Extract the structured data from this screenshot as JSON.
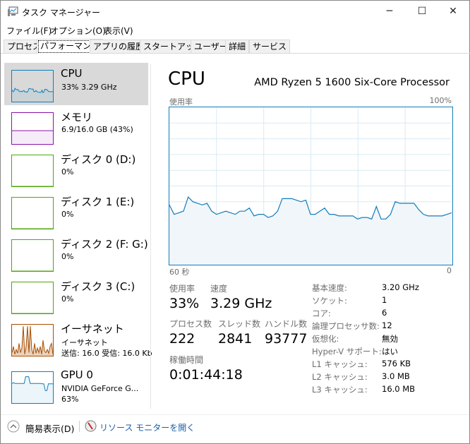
{
  "window": {
    "title": "タスク マネージャー",
    "minimize": "─",
    "maximize": "☐",
    "close": "✕"
  },
  "menu": [
    "ファイル(F)",
    "オプション(O)",
    "表示(V)"
  ],
  "tabs": [
    {
      "label": "プロセス"
    },
    {
      "label": "パフォーマンス",
      "active": true
    },
    {
      "label": "アプリの履歴"
    },
    {
      "label": "スタートアップ"
    },
    {
      "label": "ユーザー"
    },
    {
      "label": "詳細"
    },
    {
      "label": "サービス"
    }
  ],
  "sidebar": [
    {
      "name": "CPU",
      "sub": "33%  3.29 GHz",
      "color": "#117dbb",
      "selected": true,
      "spark": [
        38,
        32,
        34,
        43,
        39,
        38,
        39,
        34,
        32,
        34,
        32,
        34,
        36,
        31,
        32,
        30,
        34,
        42,
        42,
        41,
        40,
        41,
        32,
        32,
        36,
        32,
        31,
        31,
        29,
        30,
        37,
        29,
        32,
        40,
        39,
        39,
        35,
        32,
        32,
        32,
        32,
        33
      ]
    },
    {
      "name": "メモリ",
      "sub": "6.9/16.0 GB (43%)",
      "color": "#8b12ae",
      "spark": [
        43,
        43,
        43,
        43,
        43,
        43,
        43,
        43,
        43,
        43
      ]
    },
    {
      "name": "ディスク 0 (D:)",
      "sub": "0%",
      "color": "#4da60c",
      "spark": [
        0,
        0
      ]
    },
    {
      "name": "ディスク 1 (E:)",
      "sub": "0%",
      "color": "#4da60c",
      "spark": [
        0,
        0
      ]
    },
    {
      "name": "ディスク 2 (F: G:)",
      "sub": "0%",
      "color": "#4da60c",
      "spark": [
        0,
        0
      ]
    },
    {
      "name": "ディスク 3 (C:)",
      "sub": "0%",
      "color": "#4da60c",
      "spark": [
        0,
        0
      ]
    },
    {
      "name": "イーサネット",
      "sub": "イーサネット",
      "sub2": "送信: 16.0 受信: 16.0 Kb",
      "color": "#a74f01",
      "spark": [
        10,
        30,
        5,
        20,
        8,
        40,
        10,
        25,
        95,
        5,
        30,
        95,
        10,
        95,
        20,
        5,
        40,
        8,
        25,
        10,
        30,
        5,
        50,
        15,
        10,
        20,
        8,
        30,
        40,
        5
      ]
    },
    {
      "name": "GPU 0",
      "sub": "NVIDIA GeForce G...",
      "sub2": "63%",
      "color": "#117dbb",
      "spark": [
        63,
        66,
        63,
        63,
        63,
        63,
        63,
        63,
        63,
        85,
        85,
        85,
        63,
        63,
        63,
        63,
        63,
        63,
        63,
        63,
        62,
        62,
        40,
        40,
        62,
        62,
        62,
        62
      ]
    }
  ],
  "main": {
    "title": "CPU",
    "processor": "AMD Ryzen 5 1600 Six-Core Processor",
    "graph_label": "使用率",
    "graph_max": "100%",
    "graph_time": "60 秒",
    "graph_min": "0",
    "stats": {
      "usage_label": "使用率",
      "usage": "33%",
      "speed_label": "速度",
      "speed": "3.29 GHz",
      "proc_label": "プロセス数",
      "proc": "222",
      "threads_label": "スレッド数",
      "threads": "2841",
      "handles_label": "ハンドル数",
      "handles": "93777",
      "uptime_label": "稼働時間",
      "uptime": "0:01:44:18"
    },
    "details": [
      [
        "基本速度:",
        "3.20 GHz"
      ],
      [
        "ソケット:",
        "1"
      ],
      [
        "コア:",
        "6"
      ],
      [
        "論理プロセッサ数:",
        "12"
      ],
      [
        "仮想化:",
        "無効"
      ],
      [
        "Hyper-V サポート:",
        "はい"
      ],
      [
        "L1 キャッシュ:",
        "576 KB"
      ],
      [
        "L2 キャッシュ:",
        "3.0 MB"
      ],
      [
        "L3 キャッシュ:",
        "16.0 MB"
      ]
    ]
  },
  "chart_data": {
    "type": "area",
    "title": "CPU",
    "ylabel": "使用率",
    "xlabel": "60 秒",
    "ylim": [
      0,
      100
    ],
    "xlim": [
      60,
      0
    ],
    "grid": true,
    "values": [
      38,
      32,
      33,
      34,
      43,
      40,
      39,
      38,
      39,
      34,
      32,
      33,
      34,
      33,
      32,
      34,
      34,
      36,
      31,
      32,
      32,
      30,
      31,
      34,
      42,
      42,
      42,
      41,
      40,
      41,
      32,
      32,
      34,
      36,
      32,
      32,
      31,
      31,
      31,
      31,
      29,
      30,
      30,
      29,
      37,
      29,
      29,
      32,
      40,
      39,
      39,
      39,
      39,
      35,
      32,
      31,
      31,
      31,
      31,
      32,
      33
    ]
  },
  "footer": {
    "fewer": "簡易表示(D)",
    "monitor": "リソース モニターを開く"
  }
}
